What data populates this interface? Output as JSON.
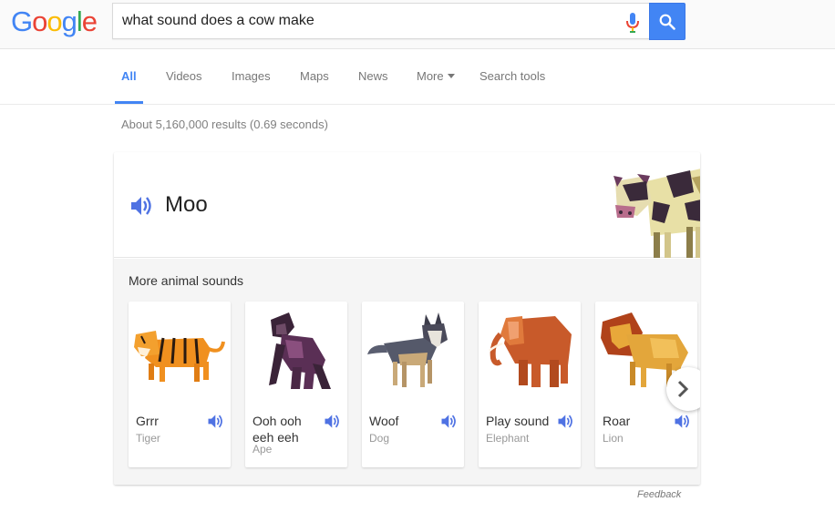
{
  "logo": {
    "letters": [
      "G",
      "o",
      "o",
      "g",
      "l",
      "e"
    ],
    "colors": [
      "#4285f4",
      "#ea4335",
      "#fbbc05",
      "#4285f4",
      "#34a853",
      "#ea4335"
    ]
  },
  "search": {
    "query": "what sound does a cow make",
    "icons": [
      "microphone-icon",
      "search-icon"
    ]
  },
  "tabs": [
    {
      "label": "All",
      "active": true
    },
    {
      "label": "Videos"
    },
    {
      "label": "Images"
    },
    {
      "label": "Maps"
    },
    {
      "label": "News"
    },
    {
      "label": "More"
    },
    {
      "label": "Search tools"
    }
  ],
  "result_stats": "About 5,160,000 results (0.69 seconds)",
  "answer": {
    "sound": "Moo",
    "icon": "speaker-icon",
    "image": "cow-illustration"
  },
  "more_sounds": {
    "title": "More animal sounds",
    "animals": [
      {
        "sound": "Grrr",
        "name": "Tiger"
      },
      {
        "sound": "Ooh ooh eeh eeh",
        "name": "Ape"
      },
      {
        "sound": "Woof",
        "name": "Dog"
      },
      {
        "sound": "Play sound",
        "name": "Elephant"
      },
      {
        "sound": "Roar",
        "name": "Lion"
      }
    ]
  },
  "feedback": "Feedback",
  "colors": {
    "accent": "#4285f4",
    "speaker": "#4f72e3"
  }
}
